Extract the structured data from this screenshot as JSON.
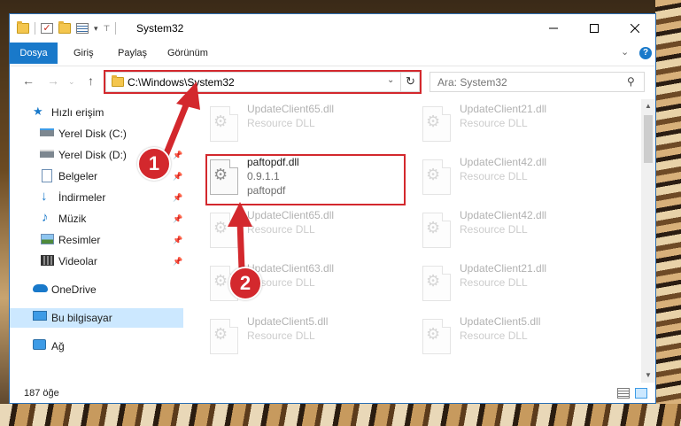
{
  "window": {
    "title": "System32"
  },
  "ribbon": {
    "tabs": [
      "Dosya",
      "Giriş",
      "Paylaş",
      "Görünüm"
    ]
  },
  "address": {
    "path": "C:\\Windows\\System32"
  },
  "search": {
    "placeholder": "Ara: System32"
  },
  "nav_pane": {
    "items": [
      {
        "label": "Hızlı erişim",
        "icon": "star-icon"
      },
      {
        "label": "Yerel Disk (C:)",
        "icon": "drive-icon"
      },
      {
        "label": "Yerel Disk (D:)",
        "icon": "drive-icon"
      },
      {
        "label": "Belgeler",
        "icon": "documents-icon"
      },
      {
        "label": "İndirmeler",
        "icon": "download-icon"
      },
      {
        "label": "Müzik",
        "icon": "music-icon"
      },
      {
        "label": "Resimler",
        "icon": "pictures-icon"
      },
      {
        "label": "Videolar",
        "icon": "videos-icon"
      },
      {
        "label": "OneDrive",
        "icon": "cloud-icon"
      },
      {
        "label": "Bu bilgisayar",
        "icon": "computer-icon"
      },
      {
        "label": "Ağ",
        "icon": "network-icon"
      }
    ]
  },
  "files": [
    {
      "name": "UpdateClient65.dll",
      "line2": "Resource DLL",
      "line3": ""
    },
    {
      "name": "UpdateClient21.dll",
      "line2": "Resource DLL",
      "line3": ""
    },
    {
      "name": "paftopdf.dll",
      "line2": "0.9.1.1",
      "line3": "paftopdf"
    },
    {
      "name": "UpdateClient42.dll",
      "line2": "Resource DLL",
      "line3": ""
    },
    {
      "name": "UpdateClient65.dll",
      "line2": "Resource DLL",
      "line3": ""
    },
    {
      "name": "UpdateClient42.dll",
      "line2": "Resource DLL",
      "line3": ""
    },
    {
      "name": "UpdateClient63.dll",
      "line2": "Resource DLL",
      "line3": ""
    },
    {
      "name": "UpdateClient21.dll",
      "line2": "Resource DLL",
      "line3": ""
    },
    {
      "name": "UpdateClient5.dll",
      "line2": "Resource DLL",
      "line3": ""
    },
    {
      "name": "UpdateClient5.dll",
      "line2": "Resource DLL",
      "line3": ""
    }
  ],
  "status": {
    "item_count": "187 öğe"
  },
  "annotations": {
    "badge1": "1",
    "badge2": "2"
  },
  "colors": {
    "accent": "#1979ca",
    "highlight_red": "#d3282d",
    "selected_bg": "#cce8ff"
  }
}
